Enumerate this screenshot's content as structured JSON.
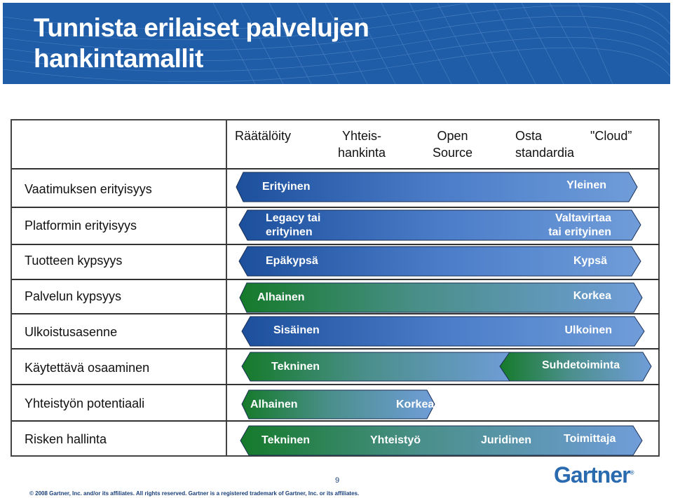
{
  "slide": {
    "title_line1": "Tunnista erilaiset palvelujen",
    "title_line2": "hankintamallit",
    "page_number": "9",
    "copyright": "© 2008 Gartner, Inc. and/or its affiliates. All rights reserved. Gartner is a registered trademark of Gartner, Inc. or its affiliates.",
    "logo": "Gartner",
    "logo_mark": "®"
  },
  "columns": [
    {
      "line1": "Räätälöity",
      "line2": ""
    },
    {
      "line1": "Yhteis-",
      "line2": "hankinta"
    },
    {
      "line1": "Open",
      "line2": "Source"
    },
    {
      "line1": "Osta",
      "line2": "standardia"
    },
    {
      "line1": "\"Cloud”",
      "line2": ""
    }
  ],
  "rows": [
    {
      "label": "Vaatimuksen erityisyys",
      "left": "Erityinen",
      "right": "Yleinen"
    },
    {
      "label": "Platformin erityisyys",
      "left_l1": "Legacy  tai",
      "left_l2": "erityinen",
      "right_l1": "Valtavirtaa",
      "right_l2": "tai erityinen"
    },
    {
      "label": "Tuotteen kypsyys",
      "left": "Epäkypsä",
      "right": "Kypsä"
    },
    {
      "label": "Palvelun kypsyys",
      "left": "Alhainen",
      "right": "Korkea"
    },
    {
      "label": "Ulkoistusasenne",
      "left": "Sisäinen",
      "right": "Ulkoinen"
    },
    {
      "label": "Käytettävä osaaminen",
      "left": "Tekninen",
      "right": "Suhdetoiminta"
    },
    {
      "label": "Yhteistyön potentiaali",
      "left": "Alhainen",
      "right": "Korkea"
    },
    {
      "label": "Risken hallinta",
      "items": [
        "Tekninen",
        "Yhteistyö",
        "Juridinen",
        "Toimittaja"
      ]
    }
  ],
  "colors": {
    "banner": "#1f5da8",
    "blue_dark": "#1c4f9c",
    "blue_light": "#6e9ad8",
    "green": "#157a2a",
    "logo": "#2a6bb0"
  }
}
